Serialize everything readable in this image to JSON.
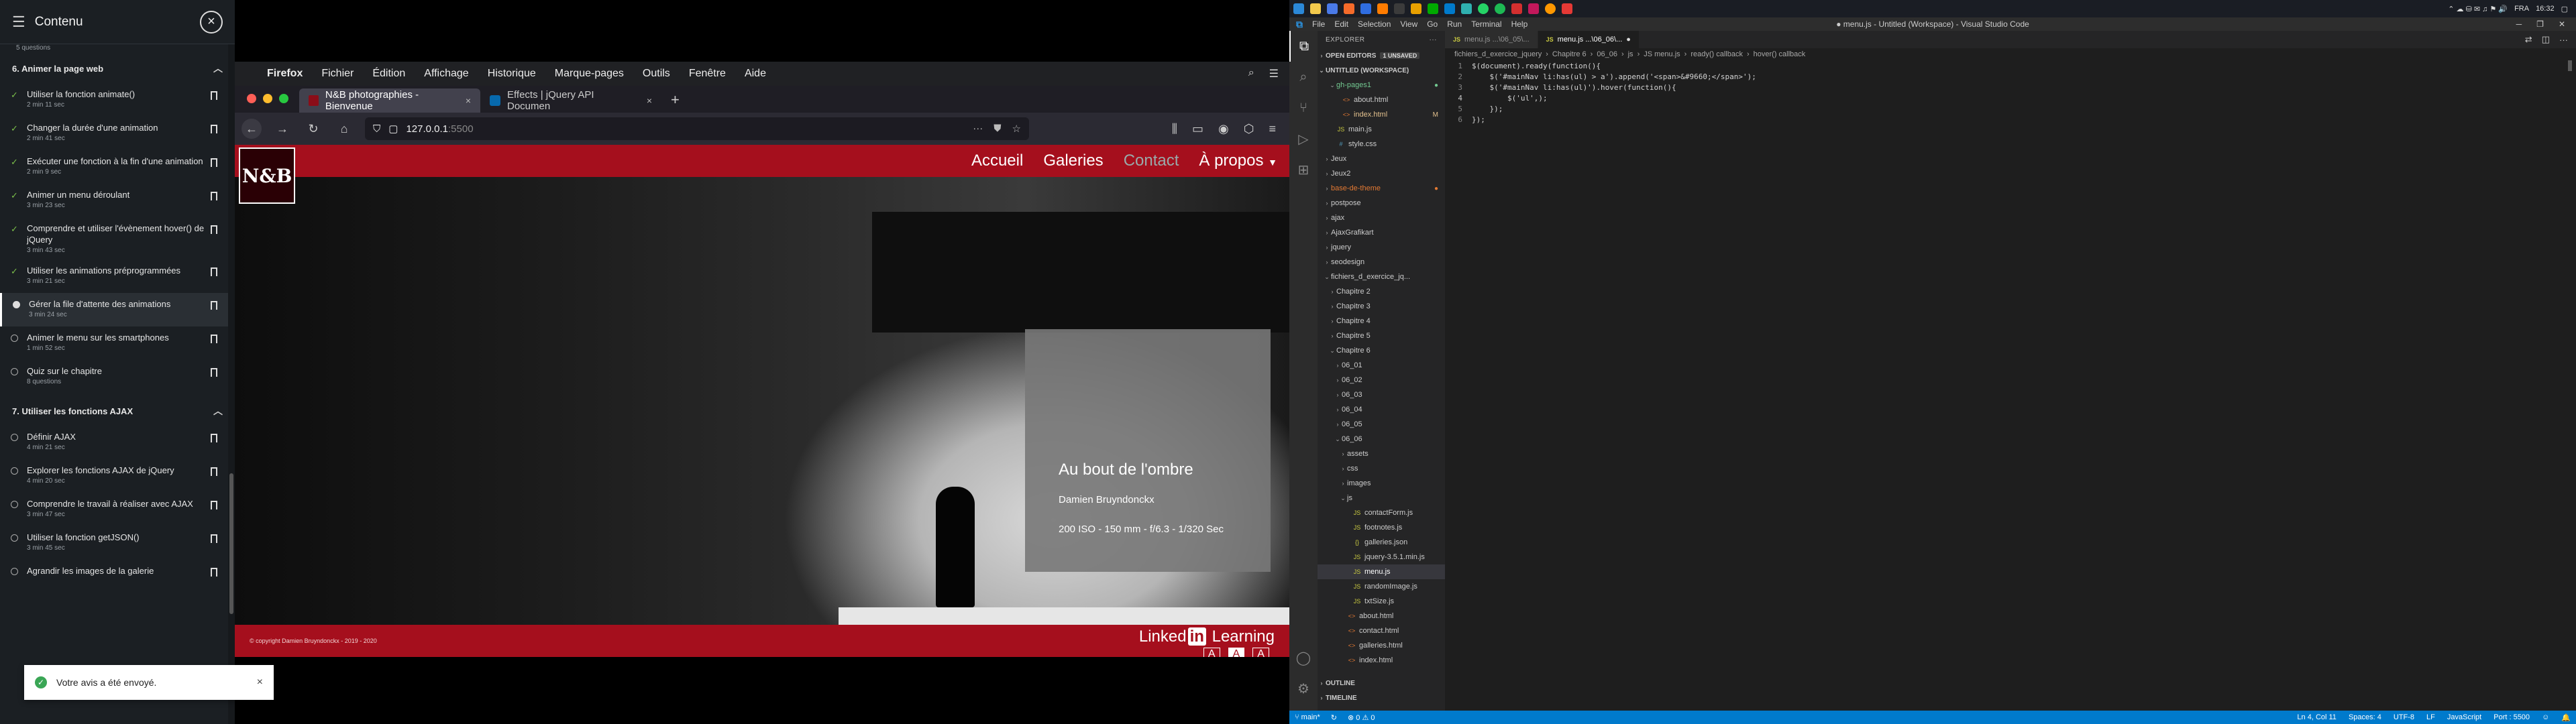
{
  "course": {
    "title": "Contenu",
    "section6_sub": "5 questions",
    "section6": "6. Animer la page web",
    "items6": [
      {
        "title": "Utiliser la fonction animate()",
        "dur": "2 min 11 sec",
        "state": "done"
      },
      {
        "title": "Changer la durée d'une animation",
        "dur": "2 min 41 sec",
        "state": "done"
      },
      {
        "title": "Exécuter une fonction à la fin d'une animation",
        "dur": "2 min 9 sec",
        "state": "done"
      },
      {
        "title": "Animer un menu déroulant",
        "dur": "3 min 23 sec",
        "state": "done"
      },
      {
        "title": "Comprendre et utiliser l'évènement hover() de jQuery",
        "dur": "3 min 43 sec",
        "state": "done"
      },
      {
        "title": "Utiliser les animations préprogrammées",
        "dur": "3 min 21 sec",
        "state": "done"
      },
      {
        "title": "Gérer la file d'attente des animations",
        "dur": "3 min 24 sec",
        "state": "active"
      },
      {
        "title": "Animer le menu sur les smartphones",
        "dur": "1 min 52 sec",
        "state": "todo"
      },
      {
        "title": "Quiz sur le chapitre",
        "dur": "8 questions",
        "state": "todo"
      }
    ],
    "section7": "7. Utiliser les fonctions AJAX",
    "items7": [
      {
        "title": "Définir AJAX",
        "dur": "4 min 21 sec",
        "state": "todo"
      },
      {
        "title": "Explorer les fonctions AJAX de jQuery",
        "dur": "4 min 20 sec",
        "state": "todo"
      },
      {
        "title": "Comprendre le travail à réaliser avec AJAX",
        "dur": "3 min 47 sec",
        "state": "todo"
      },
      {
        "title": "Utiliser la fonction getJSON()",
        "dur": "3 min 45 sec",
        "state": "todo"
      },
      {
        "title": "Agrandir les images de la galerie",
        "dur": "",
        "state": "todo"
      }
    ],
    "toast": "Votre avis a été envoyé."
  },
  "firefox": {
    "menubar": [
      "Firefox",
      "Fichier",
      "Édition",
      "Affichage",
      "Historique",
      "Marque-pages",
      "Outils",
      "Fenêtre",
      "Aide"
    ],
    "tab1": "N&B photographies - Bienvenue",
    "tab2": "Effects | jQuery API Documen",
    "url": "127.0.0.1",
    "port": ":5500"
  },
  "site": {
    "logo": "N&B",
    "menu": [
      "Accueil",
      "Galeries",
      "Contact",
      "À propos"
    ],
    "card_title": "Au bout de l'ombre",
    "card_author": "Damien Bruyndonckx",
    "card_specs": "200 ISO - 150 mm - f/6.3 - 1/320 Sec",
    "footer": "© copyright Damien Bruyndonckx - 2019 - 2020",
    "li_word": "Linked",
    "li_in": "in",
    "li_word2": " Learning",
    "li_sizes": [
      "A",
      "A",
      "A"
    ]
  },
  "taskbar": {
    "lang": "FRA",
    "time": "16:32"
  },
  "vscode": {
    "window_title": "● menu.js - Untitled (Workspace) - Visual Studio Code",
    "menu": [
      "File",
      "Edit",
      "Selection",
      "View",
      "Go",
      "Run",
      "Terminal",
      "Help"
    ],
    "explorer_title": "EXPLORER",
    "open_editors": "OPEN EDITORS",
    "unsaved": "1 UNSAVED",
    "workspace": "UNTITLED (WORKSPACE)",
    "tree": [
      {
        "d": 1,
        "a": "v",
        "i": "",
        "t": "gh-pages1",
        "c": "#73c991",
        "b": "●"
      },
      {
        "d": 2,
        "a": "",
        "i": "<>",
        "t": "about.html",
        "c": "#ccc",
        "b": ""
      },
      {
        "d": 2,
        "a": "",
        "i": "<>",
        "t": "index.html",
        "c": "#e2c08d",
        "b": "M"
      },
      {
        "d": 1,
        "a": "",
        "i": "JS",
        "t": "main.js",
        "c": "#ccc",
        "b": ""
      },
      {
        "d": 1,
        "a": "",
        "i": "#",
        "t": "style.css",
        "c": "#ccc",
        "b": ""
      },
      {
        "d": 0,
        "a": ">",
        "i": "",
        "t": "Jeux",
        "c": "#ccc",
        "b": ""
      },
      {
        "d": 0,
        "a": ">",
        "i": "",
        "t": "Jeux2",
        "c": "#ccc",
        "b": ""
      },
      {
        "d": 0,
        "a": ">",
        "i": "",
        "t": "base-de-theme",
        "c": "#e37933",
        "b": "●"
      },
      {
        "d": 0,
        "a": ">",
        "i": "",
        "t": "postpose",
        "c": "#ccc",
        "b": ""
      },
      {
        "d": 0,
        "a": ">",
        "i": "",
        "t": "ajax",
        "c": "#ccc",
        "b": ""
      },
      {
        "d": 0,
        "a": ">",
        "i": "",
        "t": "AjaxGrafikart",
        "c": "#ccc",
        "b": ""
      },
      {
        "d": 0,
        "a": ">",
        "i": "",
        "t": "jquery",
        "c": "#ccc",
        "b": ""
      },
      {
        "d": 0,
        "a": ">",
        "i": "",
        "t": "seodesign",
        "c": "#ccc",
        "b": ""
      },
      {
        "d": 0,
        "a": "v",
        "i": "",
        "t": "fichiers_d_exercice_jq...",
        "c": "#ccc",
        "b": ""
      },
      {
        "d": 1,
        "a": ">",
        "i": "",
        "t": "Chapitre 2",
        "c": "#ccc",
        "b": ""
      },
      {
        "d": 1,
        "a": ">",
        "i": "",
        "t": "Chapitre 3",
        "c": "#ccc",
        "b": ""
      },
      {
        "d": 1,
        "a": ">",
        "i": "",
        "t": "Chapitre 4",
        "c": "#ccc",
        "b": ""
      },
      {
        "d": 1,
        "a": ">",
        "i": "",
        "t": "Chapitre 5",
        "c": "#ccc",
        "b": ""
      },
      {
        "d": 1,
        "a": "v",
        "i": "",
        "t": "Chapitre 6",
        "c": "#ccc",
        "b": ""
      },
      {
        "d": 2,
        "a": ">",
        "i": "",
        "t": "06_01",
        "c": "#ccc",
        "b": ""
      },
      {
        "d": 2,
        "a": ">",
        "i": "",
        "t": "06_02",
        "c": "#ccc",
        "b": ""
      },
      {
        "d": 2,
        "a": ">",
        "i": "",
        "t": "06_03",
        "c": "#ccc",
        "b": ""
      },
      {
        "d": 2,
        "a": ">",
        "i": "",
        "t": "06_04",
        "c": "#ccc",
        "b": ""
      },
      {
        "d": 2,
        "a": ">",
        "i": "",
        "t": "06_05",
        "c": "#ccc",
        "b": ""
      },
      {
        "d": 2,
        "a": "v",
        "i": "",
        "t": "06_06",
        "c": "#ccc",
        "b": ""
      },
      {
        "d": 3,
        "a": ">",
        "i": "",
        "t": "assets",
        "c": "#ccc",
        "b": ""
      },
      {
        "d": 3,
        "a": ">",
        "i": "",
        "t": "css",
        "c": "#ccc",
        "b": ""
      },
      {
        "d": 3,
        "a": ">",
        "i": "",
        "t": "images",
        "c": "#ccc",
        "b": ""
      },
      {
        "d": 3,
        "a": "v",
        "i": "",
        "t": "js",
        "c": "#ccc",
        "b": ""
      },
      {
        "d": 4,
        "a": "",
        "i": "JS",
        "t": "contactForm.js",
        "c": "#ccc",
        "b": ""
      },
      {
        "d": 4,
        "a": "",
        "i": "JS",
        "t": "footnotes.js",
        "c": "#ccc",
        "b": ""
      },
      {
        "d": 4,
        "a": "",
        "i": "{}",
        "t": "galleries.json",
        "c": "#ccc",
        "b": ""
      },
      {
        "d": 4,
        "a": "",
        "i": "JS",
        "t": "jquery-3.5.1.min.js",
        "c": "#ccc",
        "b": ""
      },
      {
        "d": 4,
        "a": "",
        "i": "JS",
        "t": "menu.js",
        "c": "#fff",
        "b": "",
        "sel": true
      },
      {
        "d": 4,
        "a": "",
        "i": "JS",
        "t": "randomImage.js",
        "c": "#ccc",
        "b": ""
      },
      {
        "d": 4,
        "a": "",
        "i": "JS",
        "t": "txtSize.js",
        "c": "#ccc",
        "b": ""
      },
      {
        "d": 3,
        "a": "",
        "i": "<>",
        "t": "about.html",
        "c": "#ccc",
        "b": ""
      },
      {
        "d": 3,
        "a": "",
        "i": "<>",
        "t": "contact.html",
        "c": "#ccc",
        "b": ""
      },
      {
        "d": 3,
        "a": "",
        "i": "<>",
        "t": "galleries.html",
        "c": "#ccc",
        "b": ""
      },
      {
        "d": 3,
        "a": "",
        "i": "<>",
        "t": "index.html",
        "c": "#ccc",
        "b": ""
      }
    ],
    "outline": "OUTLINE",
    "timeline": "TIMELINE",
    "tab1": "menu.js ...\\06_05\\...",
    "tab2": "menu.js ...\\06_06\\...",
    "crumbs": [
      "fichiers_d_exercice_jquery",
      "Chapitre 6",
      "06_06",
      "js",
      "JS menu.js",
      "ready() callback",
      "hover() callback"
    ],
    "code": [
      "$(document).ready(function(){",
      "    $('#mainNav li:has(ul) > a').append('<span>&#9660;</span>');",
      "    $('#mainNav li:has(ul)').hover(function(){",
      "        $('ul',);",
      "    });",
      "});"
    ],
    "cursor_line": 4,
    "status": {
      "branch": "main*",
      "errors": "⊗ 0 ⚠ 0",
      "pos": "Ln 4, Col 11",
      "spaces": "Spaces: 4",
      "enc": "UTF-8",
      "eol": "LF",
      "lang": "JavaScript",
      "port": "Port : 5500"
    }
  },
  "colors": {
    "brand_red": "#a50f1d",
    "vscode_blue": "#007acc",
    "done_green": "#7bbf4a"
  }
}
